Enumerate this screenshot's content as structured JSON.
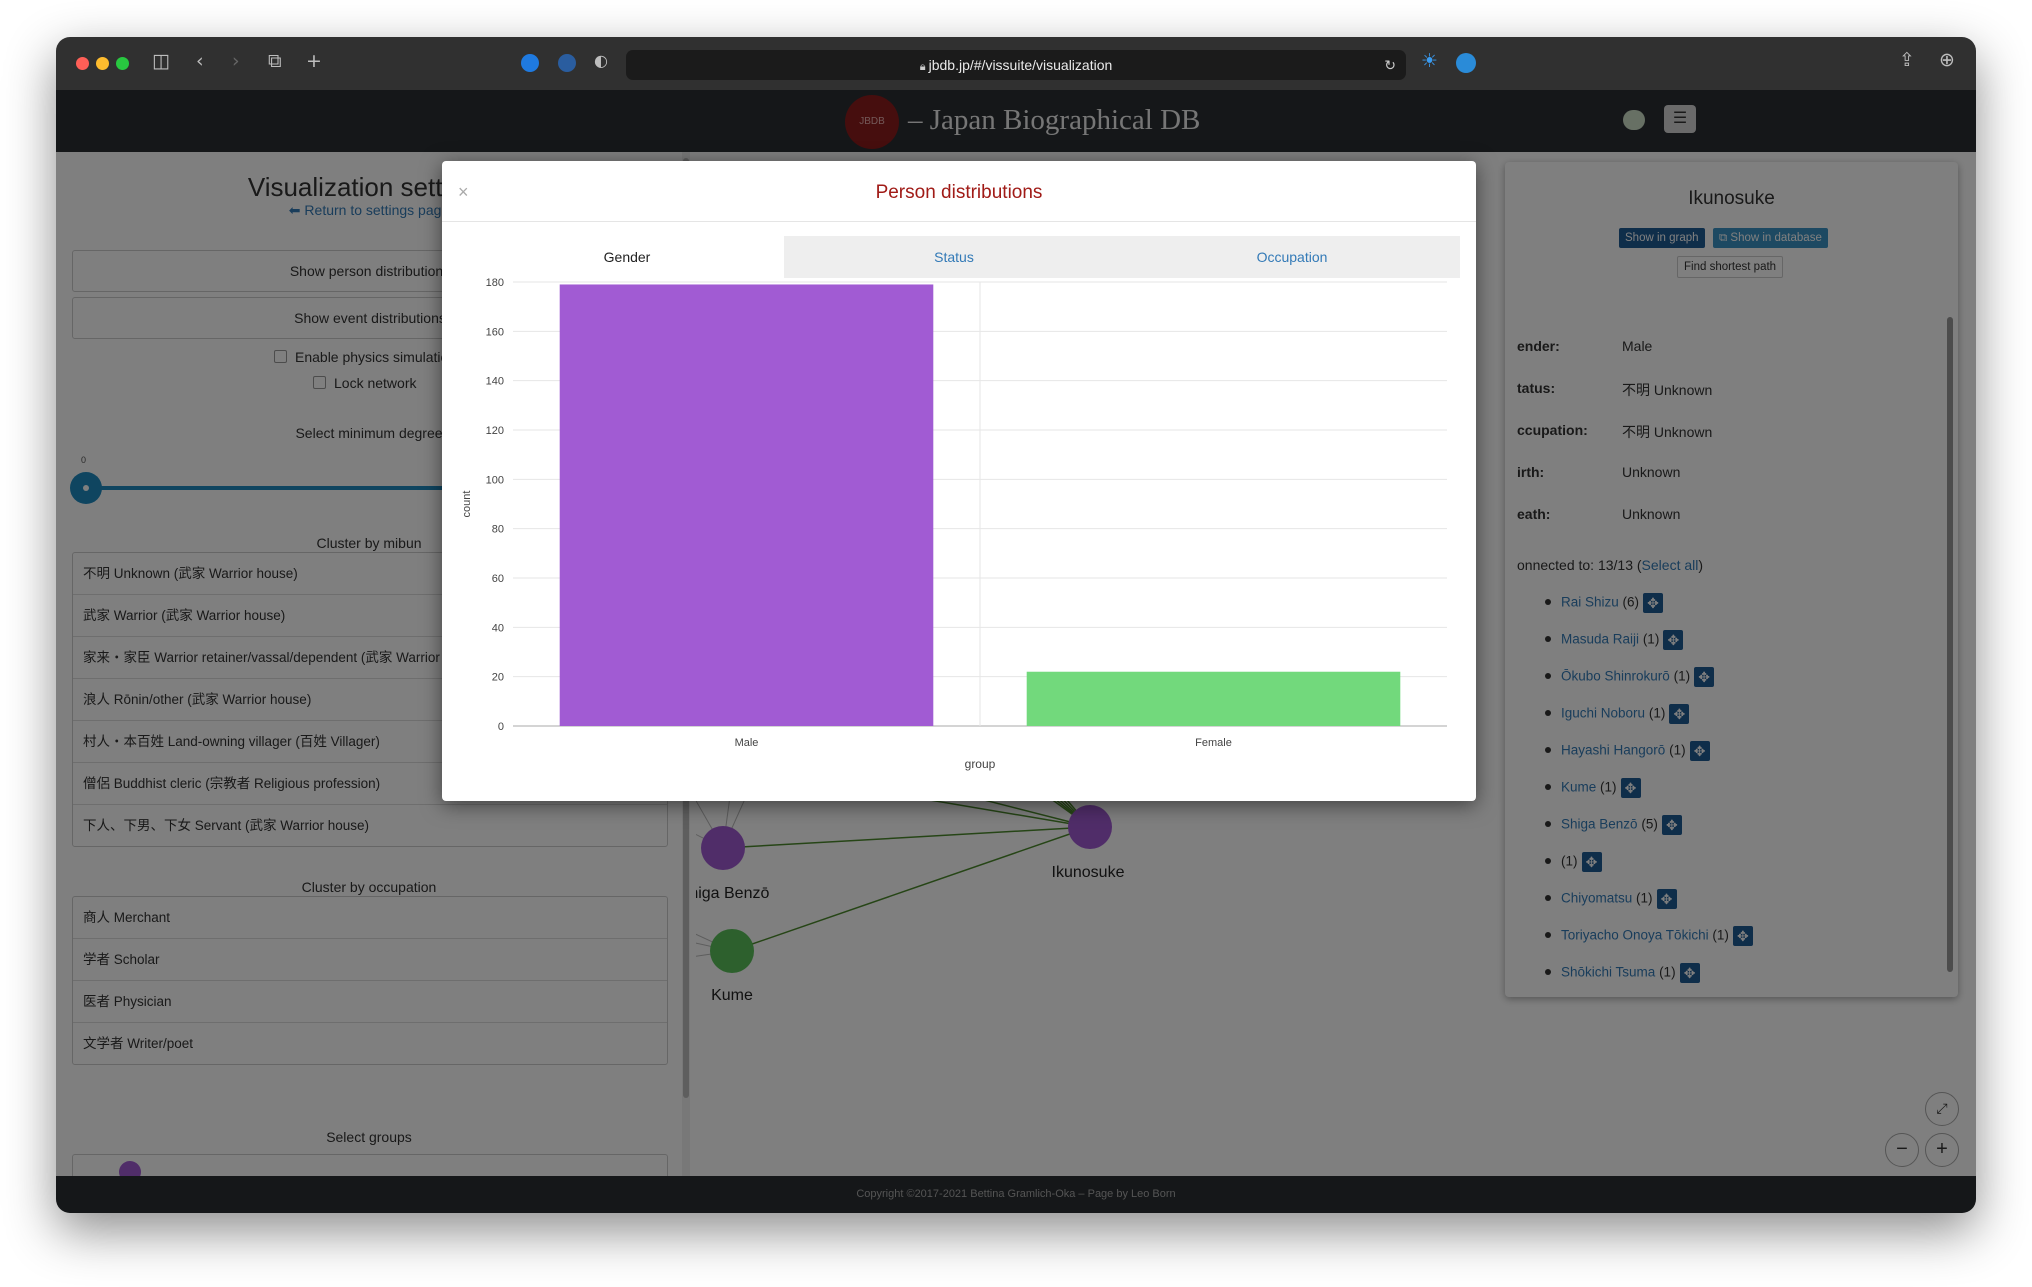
{
  "browser": {
    "url": "jbdb.jp/#/vissuite/visualization"
  },
  "navbar": {
    "logo_text": "JBDB",
    "title": "– Japan Biographical DB"
  },
  "left_panel": {
    "title": "Visualization settings",
    "return_link": "⬅ Return to settings page",
    "btn_person": "Show person distributions",
    "btn_event": "Show event distributions",
    "chk_physics": "Enable physics simulation",
    "chk_lock": "Lock network",
    "degree_label": "Select minimum degree",
    "degree_value": "0",
    "mibun_label": "Cluster by mibun",
    "mibun_items": [
      "不明 Unknown (武家 Warrior house)",
      "武家 Warrior (武家 Warrior house)",
      "家来・家臣 Warrior retainer/vassal/dependent (武家 Warrior house)",
      "浪人 Rōnin/other (武家 Warrior house)",
      "村人・本百姓 Land-owning villager (百姓 Villager)",
      "僧侶 Buddhist cleric (宗教者 Religious profession)",
      "下人、下男、下女 Servant (武家 Warrior house)"
    ],
    "occupation_label": "Cluster by occupation",
    "occupation_items": [
      "商人 Merchant",
      "学者 Scholar",
      "医者 Physician",
      "文学者 Writer/poet"
    ],
    "groups_label": "Select groups"
  },
  "graph": {
    "nodes": [
      {
        "label": "Shiga Benzō",
        "color": "#a15bd3"
      },
      {
        "label": "Ikunosuke",
        "color": "#a15bd3"
      },
      {
        "label": "Kume",
        "color": "#5ac15a"
      }
    ]
  },
  "right_panel": {
    "name": "Ikunosuke",
    "btn_show_graph": "Show in graph",
    "btn_show_db": "Show in database",
    "btn_shortest": "Find shortest path",
    "fields": [
      {
        "key": "ender:",
        "value": "Male"
      },
      {
        "key": "tatus:",
        "value": "不明 Unknown"
      },
      {
        "key": "ccupation:",
        "value": "不明 Unknown"
      },
      {
        "key": "irth:",
        "value": "Unknown"
      },
      {
        "key": "eath:",
        "value": "Unknown"
      }
    ],
    "connected_text": "onnected to: 13/13 (",
    "select_all": "Select all",
    "connected_close": ")",
    "connections": [
      {
        "name": "Rai Shizu",
        "count": "(6)"
      },
      {
        "name": "Masuda Raiji",
        "count": "(1)"
      },
      {
        "name": "Ōkubo Shinrokurō",
        "count": "(1)"
      },
      {
        "name": "Iguchi Noboru",
        "count": "(1)"
      },
      {
        "name": "Hayashi Hangorō",
        "count": "(1)"
      },
      {
        "name": "Kume",
        "count": "(1)"
      },
      {
        "name": "Shiga Benzō",
        "count": "(5)"
      },
      {
        "name": "",
        "count": "(1)"
      },
      {
        "name": "Chiyomatsu",
        "count": "(1)"
      },
      {
        "name": "Toriyacho Onoya Tōkichi",
        "count": "(1)"
      },
      {
        "name": "Shōkichi Tsuma",
        "count": "(1)"
      }
    ]
  },
  "footer": {
    "text": "Copyright ©2017-2021 Bettina Gramlich-Oka – Page by Leo Born"
  },
  "modal": {
    "close": "×",
    "title": "Person distributions",
    "tabs": [
      "Gender",
      "Status",
      "Occupation"
    ],
    "active_tab": "Gender"
  },
  "colors": {
    "male_bar": "#a15bd3",
    "female_bar": "#72d97c",
    "accent_blue": "#337ab7",
    "title_red": "#a01b17"
  },
  "chart_data": {
    "type": "bar",
    "categories": [
      "Male",
      "Female"
    ],
    "values": [
      179,
      22
    ],
    "colors": [
      "#a15bd3",
      "#72d97c"
    ],
    "xlabel": "group",
    "ylabel": "count",
    "ylim": [
      0,
      180
    ],
    "yticks": [
      0,
      20,
      40,
      60,
      80,
      100,
      120,
      140,
      160,
      180
    ],
    "grid": true
  }
}
